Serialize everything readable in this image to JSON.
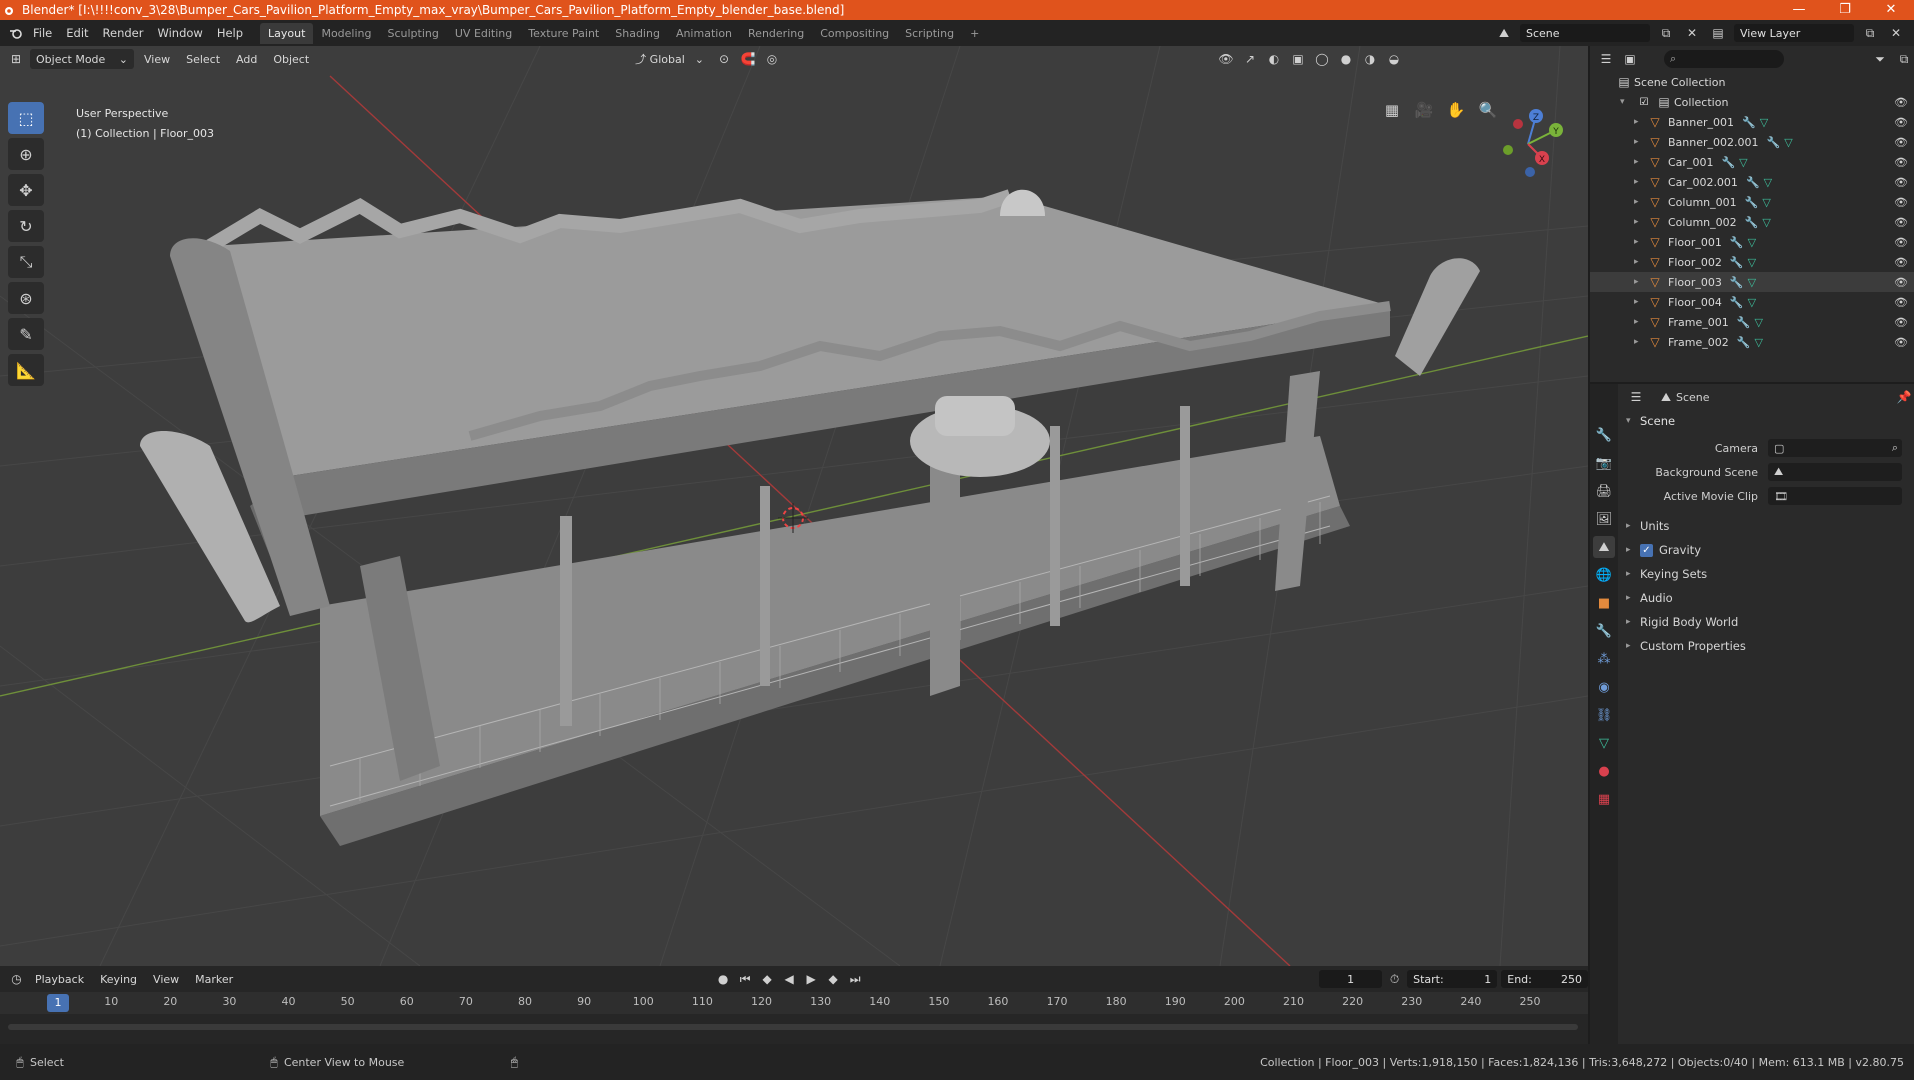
{
  "window": {
    "title": "Blender* [I:\\!!!!conv_3\\28\\Bumper_Cars_Pavilion_Platform_Empty_max_vray\\Bumper_Cars_Pavilion_Platform_Empty_blender_base.blend]",
    "minimize": "—",
    "maximize": "❐",
    "close": "✕"
  },
  "menu": [
    "File",
    "Edit",
    "Render",
    "Window",
    "Help"
  ],
  "workspaces": [
    "Layout",
    "Modeling",
    "Sculpting",
    "UV Editing",
    "Texture Paint",
    "Shading",
    "Animation",
    "Rendering",
    "Compositing",
    "Scripting",
    "+"
  ],
  "active_workspace": "Layout",
  "scene_field": "Scene",
  "view_layer_field": "View Layer",
  "viewport": {
    "mode": "Object Mode",
    "menus": [
      "View",
      "Select",
      "Add",
      "Object"
    ],
    "transform_orientation": "Global",
    "perspective_label": "User Perspective",
    "collection_label": "(1) Collection | Floor_003",
    "axes": {
      "x": "X",
      "y": "Y",
      "z": "Z"
    }
  },
  "timeline": {
    "menus": [
      "Playback",
      "Keying",
      "View",
      "Marker"
    ],
    "current_frame": "1",
    "start_label": "Start:",
    "start_value": "1",
    "end_label": "End:",
    "end_value": "250",
    "ticks": [
      "1",
      "10",
      "20",
      "30",
      "40",
      "50",
      "60",
      "70",
      "80",
      "90",
      "100",
      "110",
      "120",
      "130",
      "140",
      "150",
      "160",
      "170",
      "180",
      "190",
      "200",
      "210",
      "220",
      "230",
      "240",
      "250"
    ]
  },
  "statusbar": {
    "select": "Select",
    "center_view": "Center View to Mouse",
    "stats": "Collection | Floor_003 | Verts:1,918,150 | Faces:1,824,136 | Tris:3,648,272 | Objects:0/40 | Mem: 613.1 MB | v2.80.75"
  },
  "outliner": {
    "scene_collection": "Scene Collection",
    "collection": "Collection",
    "items": [
      "Banner_001",
      "Banner_002.001",
      "Car_001",
      "Car_002.001",
      "Column_001",
      "Column_002",
      "Floor_001",
      "Floor_002",
      "Floor_003",
      "Floor_004",
      "Frame_001",
      "Frame_002"
    ],
    "selected": "Floor_003"
  },
  "properties": {
    "context": "Scene",
    "panel": "Scene",
    "camera_label": "Camera",
    "background_scene_label": "Background Scene",
    "active_clip_label": "Active Movie Clip",
    "subpanels": [
      "Units",
      "Gravity",
      "Keying Sets",
      "Audio",
      "Rigid Body World",
      "Custom Properties"
    ]
  }
}
